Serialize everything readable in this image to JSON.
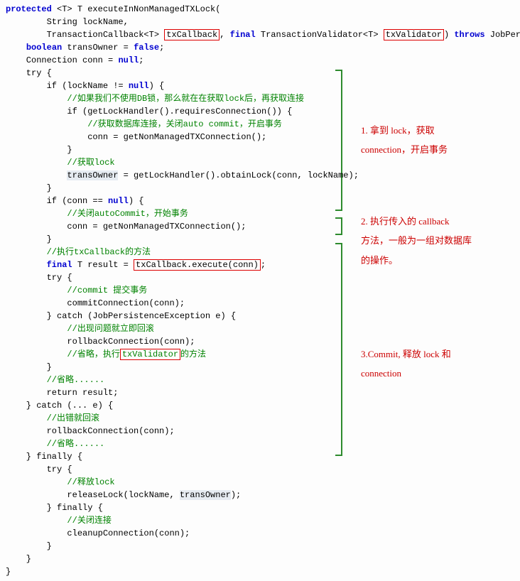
{
  "code": {
    "l1a": "protected",
    "l1b": " <T> T executeInNonManagedTXLock(",
    "l2a": "        String lockName,",
    "l3a": "        TransactionCallback<T> ",
    "l3_box1": "txCallback",
    "l3b": ", ",
    "l3_final": "final",
    "l3c": " TransactionValidator<T> ",
    "l3_box2": "txValidator",
    "l3d": ") ",
    "l3_throws": "throws",
    "l3e": " JobPersistenceException {",
    "l4a": "    ",
    "l4_bool": "boolean",
    "l4b": " transOwner = ",
    "l4_false": "false",
    "l4c": ";",
    "l5a": "    Connection conn = ",
    "l5_null": "null",
    "l5b": ";",
    "l6a": "    try {",
    "l7a": "        if (lockName != ",
    "l7_null": "null",
    "l7b": ") {",
    "l8cm": "            //如果我们不使用DB锁，那么就在在获取lock后，再获取连接",
    "l9a": "            if (getLockHandler().requiresConnection()) {",
    "l10cm": "                //获取数据库连接，关闭auto commit，开启事务",
    "l11a": "                conn = getNonManagedTXConnection();",
    "l12a": "            }",
    "l13cm": "            //获取lock",
    "l14a": "            ",
    "l14_hl": "transOwner",
    "l14b": " = getLockHandler().obtainLock(conn, lockName);",
    "l15a": "        }",
    "l16a": "        if (conn == ",
    "l16_null": "null",
    "l16b": ") {",
    "l17cm": "            //关闭autoCommit，开始事务",
    "l18a": "            conn = getNonManagedTXConnection();",
    "l19a": "        }",
    "l20cm": "        //执行txCallback的方法",
    "l21a": "        ",
    "l21_final": "final",
    "l21b": " T result = ",
    "l21_box": "txCallback.execute(conn)",
    "l21c": ";",
    "l22a": "        try {",
    "l23cm": "            //commit 提交事务",
    "l24a": "            commitConnection(conn);",
    "l25a": "        } catch (JobPersistenceException e) {",
    "l26cm": "            //出现问题就立即回滚",
    "l27a": "            rollbackConnection(conn);",
    "l28cm_a": "            //省略，执行",
    "l28_box": "txValidator",
    "l28cm_b": "的方法",
    "l29a": "        }",
    "l30cm": "        //省略......",
    "l31a": "        return result;",
    "l32a": "    } catch (... e) {",
    "l33cm": "        //出错就回滚",
    "l34a": "        rollbackConnection(conn);",
    "l35cm": "        //省略......",
    "l36a": "    } finally {",
    "l37a": "        try {",
    "l38cm": "            //释放lock",
    "l39a": "            releaseLock(lockName, ",
    "l39_hl": "transOwner",
    "l39b": ");",
    "l40a": "        } finally {",
    "l41cm": "            //关闭连接",
    "l42a": "            cleanupConnection(conn);",
    "l43a": "        }",
    "l44a": "    }",
    "l45a": "}"
  },
  "annotations": {
    "a1_l1": "1. 拿到 lock，获取",
    "a1_l2": "connection，开启事务",
    "a2_l1": "2. 执行传入的 callback",
    "a2_l2": "方法，一般为一组对数据库",
    "a2_l3": "的操作。",
    "a3_l1": "3.Commit, 释放 lock 和",
    "a3_l2": "connection"
  }
}
